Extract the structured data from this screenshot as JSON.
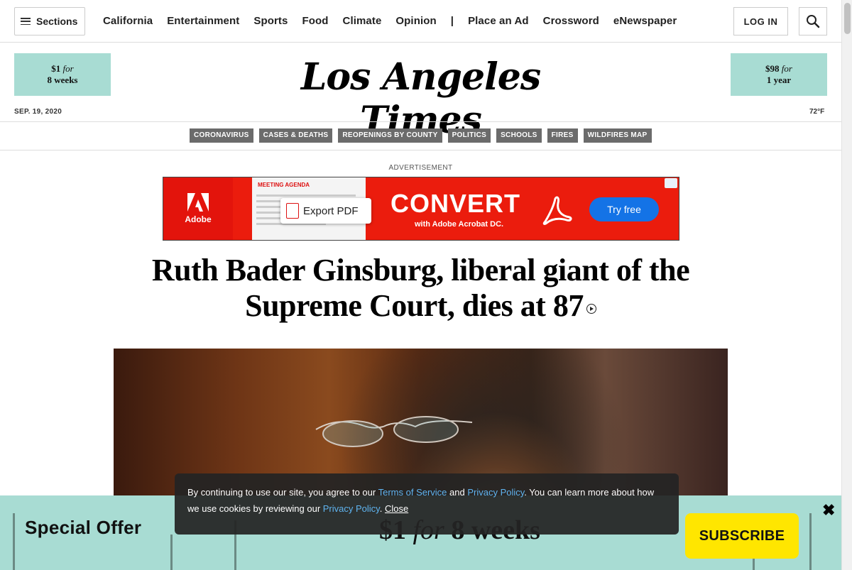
{
  "nav": {
    "sections_label": "Sections",
    "links": [
      "California",
      "Entertainment",
      "Sports",
      "Food",
      "Climate",
      "Opinion",
      "|",
      "Place an Ad",
      "Crossword",
      "eNewspaper"
    ],
    "login_label": "LOG IN"
  },
  "masthead": {
    "promo_left": {
      "price": "$1",
      "for": "for",
      "term": "8 weeks"
    },
    "promo_right": {
      "price": "$98",
      "for": "for",
      "term": "1 year"
    },
    "logo": "Los Angeles Times",
    "date": "SEP. 19, 2020",
    "temperature": "72°F"
  },
  "topics": [
    "CORONAVIRUS",
    "CASES & DEATHS",
    "REOPENINGS BY COUNTY",
    "POLITICS",
    "SCHOOLS",
    "FIRES",
    "WILDFIRES MAP"
  ],
  "ad": {
    "label": "ADVERTISEMENT",
    "brand": "Adobe",
    "doc_heading": "MEETING AGENDA",
    "export_label": "Export PDF",
    "headline": "CONVERT",
    "subline": "with Adobe Acrobat DC.",
    "cta": "Try free"
  },
  "article": {
    "headline": "Ruth Bader Ginsburg, liberal giant of the Supreme Court, dies at 87"
  },
  "cookie": {
    "text1": "By continuing to use our site, you agree to our ",
    "terms_link": "Terms of Service",
    "and": " and ",
    "privacy_link": "Privacy Policy",
    "text2": ". You can learn more about how we use cookies by reviewing our ",
    "privacy_link2": "Privacy Policy",
    "text3": ". ",
    "close_label": "Close"
  },
  "offer": {
    "title": "Special Offer",
    "price": "$1",
    "for": "for",
    "term": "8 weeks",
    "subscribe_label": "SUBSCRIBE",
    "close_glyph": "✖"
  },
  "colors": {
    "promo_bg": "#a8dcd3",
    "topic_bg": "#6b6b6b",
    "ad_red": "#eb1c0d",
    "subscribe_yellow": "#ffe600",
    "link_blue": "#5fb4f0"
  }
}
